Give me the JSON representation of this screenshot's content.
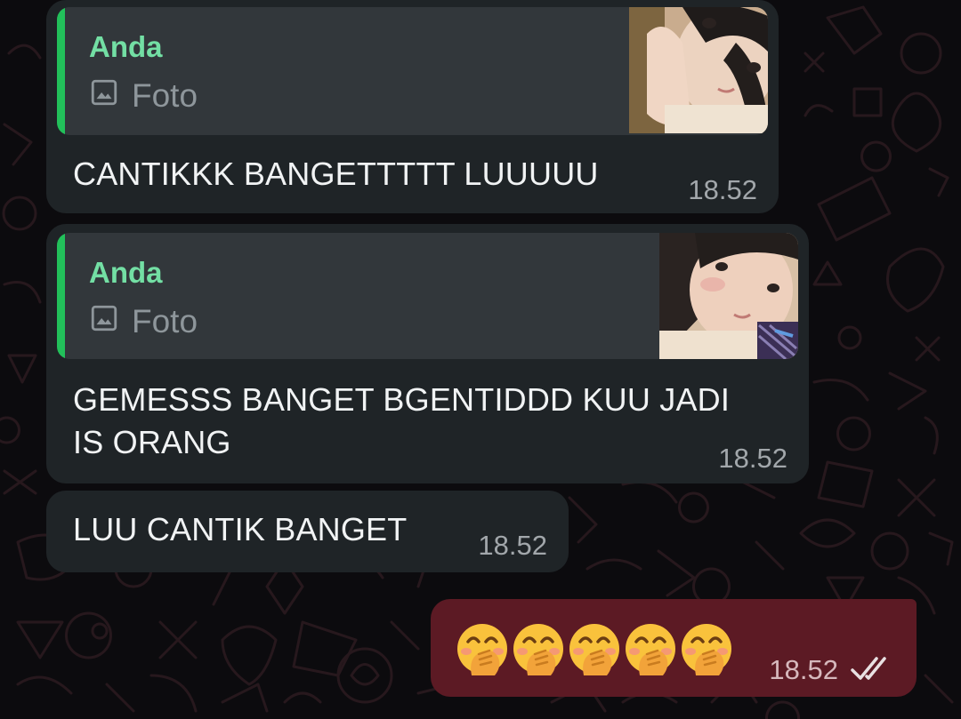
{
  "messages": [
    {
      "quote": {
        "author": "Anda",
        "type_label": "Foto"
      },
      "text": "CANTIKKK BANGETTTTT LUUUUU",
      "time": "18.52"
    },
    {
      "quote": {
        "author": "Anda",
        "type_label": "Foto"
      },
      "text_line1": "GEMESSS BANGET BGENTIDDD KUU JADI",
      "text_line2": "IS ORANG",
      "time": "18.52"
    },
    {
      "text": "LUU CANTIK BANGET",
      "time": "18.52"
    },
    {
      "emojis": [
        "🤭",
        "🤭",
        "🤭",
        "🤭",
        "🤭"
      ],
      "time": "18.52",
      "status": "read"
    }
  ],
  "colors": {
    "incoming_bubble": "#1f2427",
    "outgoing_bubble": "#5c1a24",
    "quote_accent": "#22c05a",
    "quote_author": "#73dfa4",
    "wallpaper": "#0c0b0e"
  },
  "icons": {
    "photo": "image-icon",
    "read_receipt": "double-check-icon"
  }
}
